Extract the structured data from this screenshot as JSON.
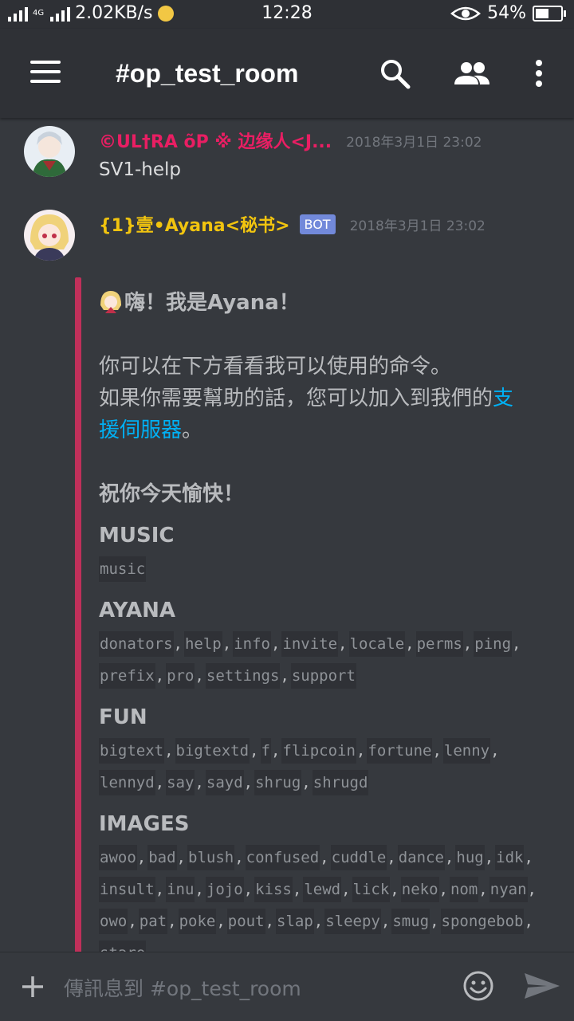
{
  "status": {
    "net_type": "4G",
    "net_speed": "2.02KB/s",
    "time": "12:28",
    "battery": "54%",
    "battery_level": 0.54
  },
  "header": {
    "channel": "#op_test_room",
    "icons": [
      "menu-icon",
      "search-icon",
      "members-icon",
      "more-vertical-icon"
    ]
  },
  "messages": [
    {
      "author": "©UL†RA õP ※ 边缘人<J...",
      "author_color": "#e91e63",
      "timestamp": "2018年3月1日 23:02",
      "text": "SV1-help"
    },
    {
      "author": "{1}壹•Ayana<秘书>",
      "author_color": "#f1c40f",
      "badge": "BOT",
      "timestamp": "2018年3月1日 23:02"
    }
  ],
  "embed": {
    "greeting": "嗨！我是Ayana！",
    "line1": "你可以在下方看看我可以使用的命令。",
    "line2_pre": "如果你需要幫助的話，您可以加入到我們的",
    "line2_link1": "支",
    "line3_link2": "援伺服器",
    "line3_post": "。",
    "wish": "祝你今天愉快！",
    "sections": [
      {
        "heading": "MUSIC",
        "commands": [
          "music"
        ]
      },
      {
        "heading": "AYANA",
        "commands": [
          "donators",
          "help",
          "info",
          "invite",
          "locale",
          "perms",
          "ping",
          "prefix",
          "pro",
          "settings",
          "support"
        ]
      },
      {
        "heading": "FUN",
        "commands": [
          "bigtext",
          "bigtextd",
          "f",
          "flipcoin",
          "fortune",
          "lenny",
          "lennyd",
          "say",
          "sayd",
          "shrug",
          "shrugd"
        ]
      },
      {
        "heading": "IMAGES",
        "commands": [
          "awoo",
          "bad",
          "blush",
          "confused",
          "cuddle",
          "dance",
          "hug",
          "idk",
          "insult",
          "inu",
          "jojo",
          "kiss",
          "lewd",
          "lick",
          "neko",
          "nom",
          "nyan",
          "owo",
          "pat",
          "poke",
          "pout",
          "slap",
          "sleepy",
          "smug",
          "spongebob",
          "stare"
        ]
      }
    ]
  },
  "input": {
    "placeholder": "傳訊息到 #op_test_room"
  },
  "colors": {
    "background": "#36393e",
    "embed_bar": "#c0305a",
    "link": "#00b0f4",
    "bot_badge": "#7289da"
  }
}
